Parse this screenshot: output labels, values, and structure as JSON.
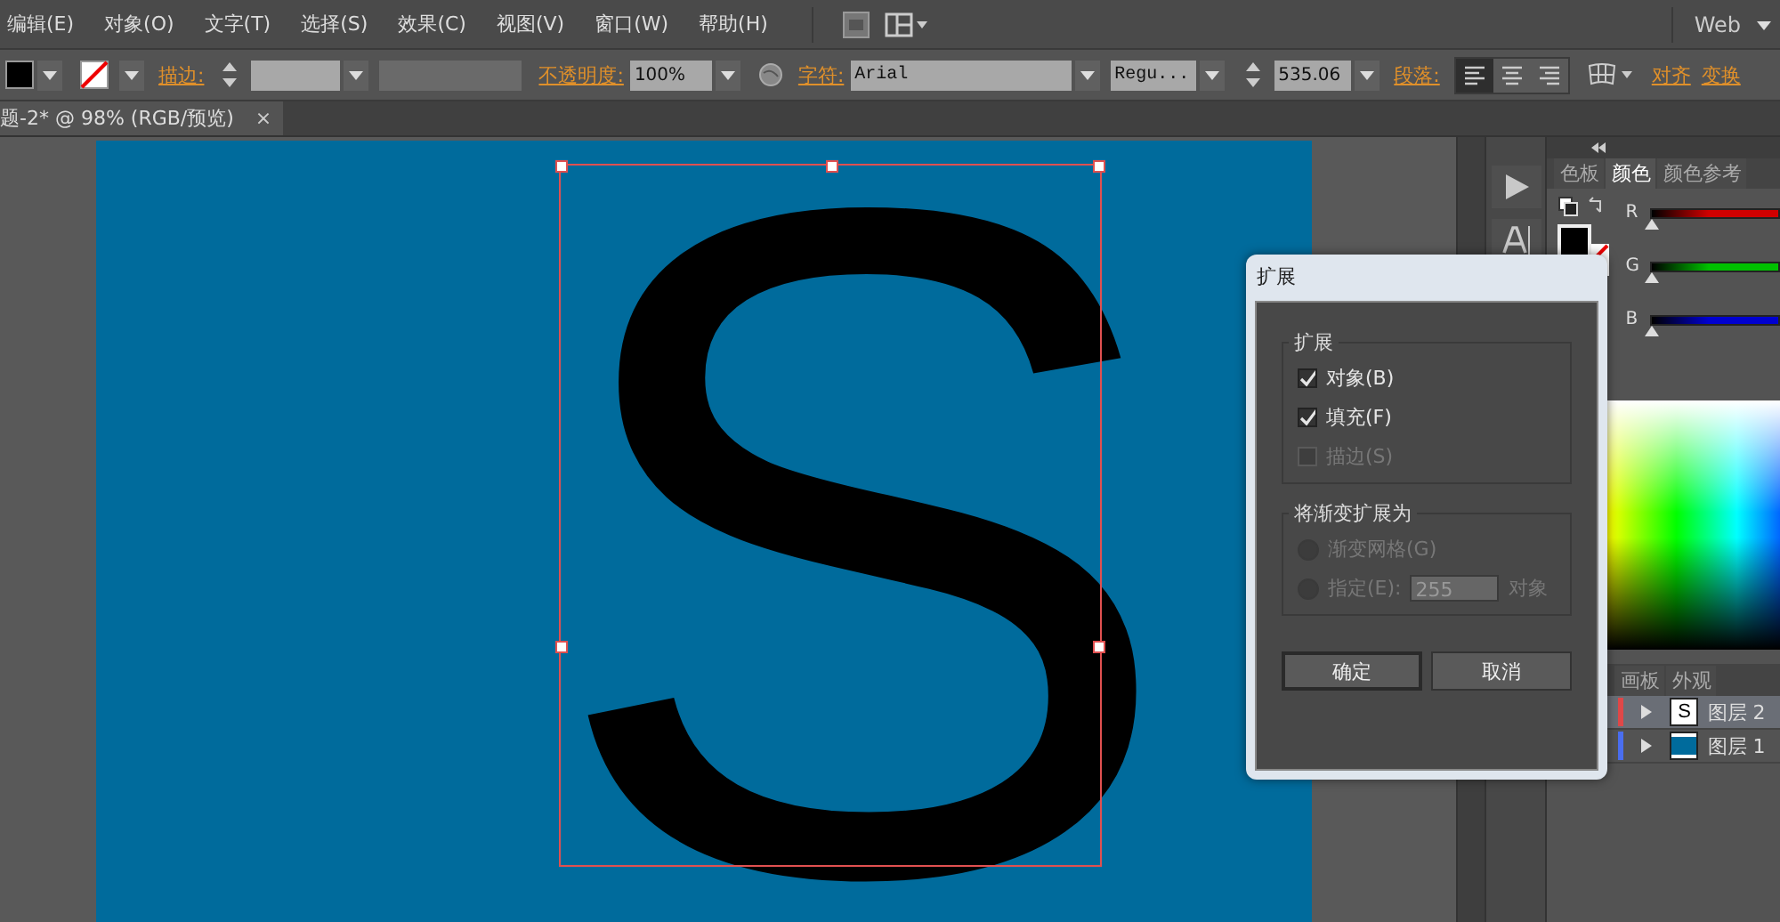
{
  "menu_bar": {
    "items": [
      "编辑(E)",
      "对象(O)",
      "文字(T)",
      "选择(S)",
      "效果(C)",
      "视图(V)",
      "窗口(W)",
      "帮助(H)"
    ],
    "workspace": "Web"
  },
  "control_bar": {
    "stroke_label": "描边:",
    "opacity_label": "不透明度:",
    "opacity": "100%",
    "character_label": "字符:",
    "font": "Arial",
    "font_style": "Regu...",
    "font_size": "535.06",
    "paragraph_label": "段落:",
    "align_buttons": [
      {
        "kind": "left",
        "selected": true
      },
      {
        "kind": "center",
        "selected": false
      },
      {
        "kind": "right",
        "selected": false
      }
    ],
    "align_link": "对齐",
    "transform_link": "变换"
  },
  "document_tab": {
    "title": "题-2* @ 98% (RGB/预览)",
    "close": "×"
  },
  "canvas": {
    "text_object": "S"
  },
  "color_panel": {
    "tabs": [
      {
        "label": "色板",
        "selected": false
      },
      {
        "label": "颜色",
        "selected": true
      },
      {
        "label": "颜色参考",
        "selected": false
      }
    ],
    "channels": [
      {
        "name": "R",
        "color": "#d00000",
        "level": 0
      },
      {
        "name": "G",
        "color": "#00c000",
        "level": 0
      },
      {
        "name": "B",
        "color": "#0000d0",
        "level": 0
      }
    ]
  },
  "layers_panel": {
    "tabs": [
      {
        "label": "画板",
        "selected": false
      },
      {
        "label": "外观",
        "selected": false
      }
    ],
    "layers": [
      {
        "name": "图层 2",
        "color": "#e04848",
        "thumbnail_text": "S",
        "selected": true
      },
      {
        "name": "图层 1",
        "color": "#4a6ef0",
        "selected": false
      }
    ]
  },
  "dialog": {
    "title": "扩展",
    "expand_group": {
      "legend": "扩展",
      "options": [
        {
          "label": "对象(B)",
          "checked": true,
          "disabled": false
        },
        {
          "label": "填充(F)",
          "checked": true,
          "disabled": false
        },
        {
          "label": "描边(S)",
          "checked": false,
          "disabled": true
        }
      ]
    },
    "gradient_group": {
      "legend": "将渐变扩展为",
      "options": [
        {
          "label": "渐变网格(G)",
          "selected": false,
          "disabled": true
        },
        {
          "label": "指定(E):",
          "selected": false,
          "disabled": true,
          "value": "255",
          "suffix": "对象"
        }
      ]
    },
    "buttons": [
      {
        "label": "确定",
        "default": true
      },
      {
        "label": "取消",
        "default": false
      }
    ]
  }
}
